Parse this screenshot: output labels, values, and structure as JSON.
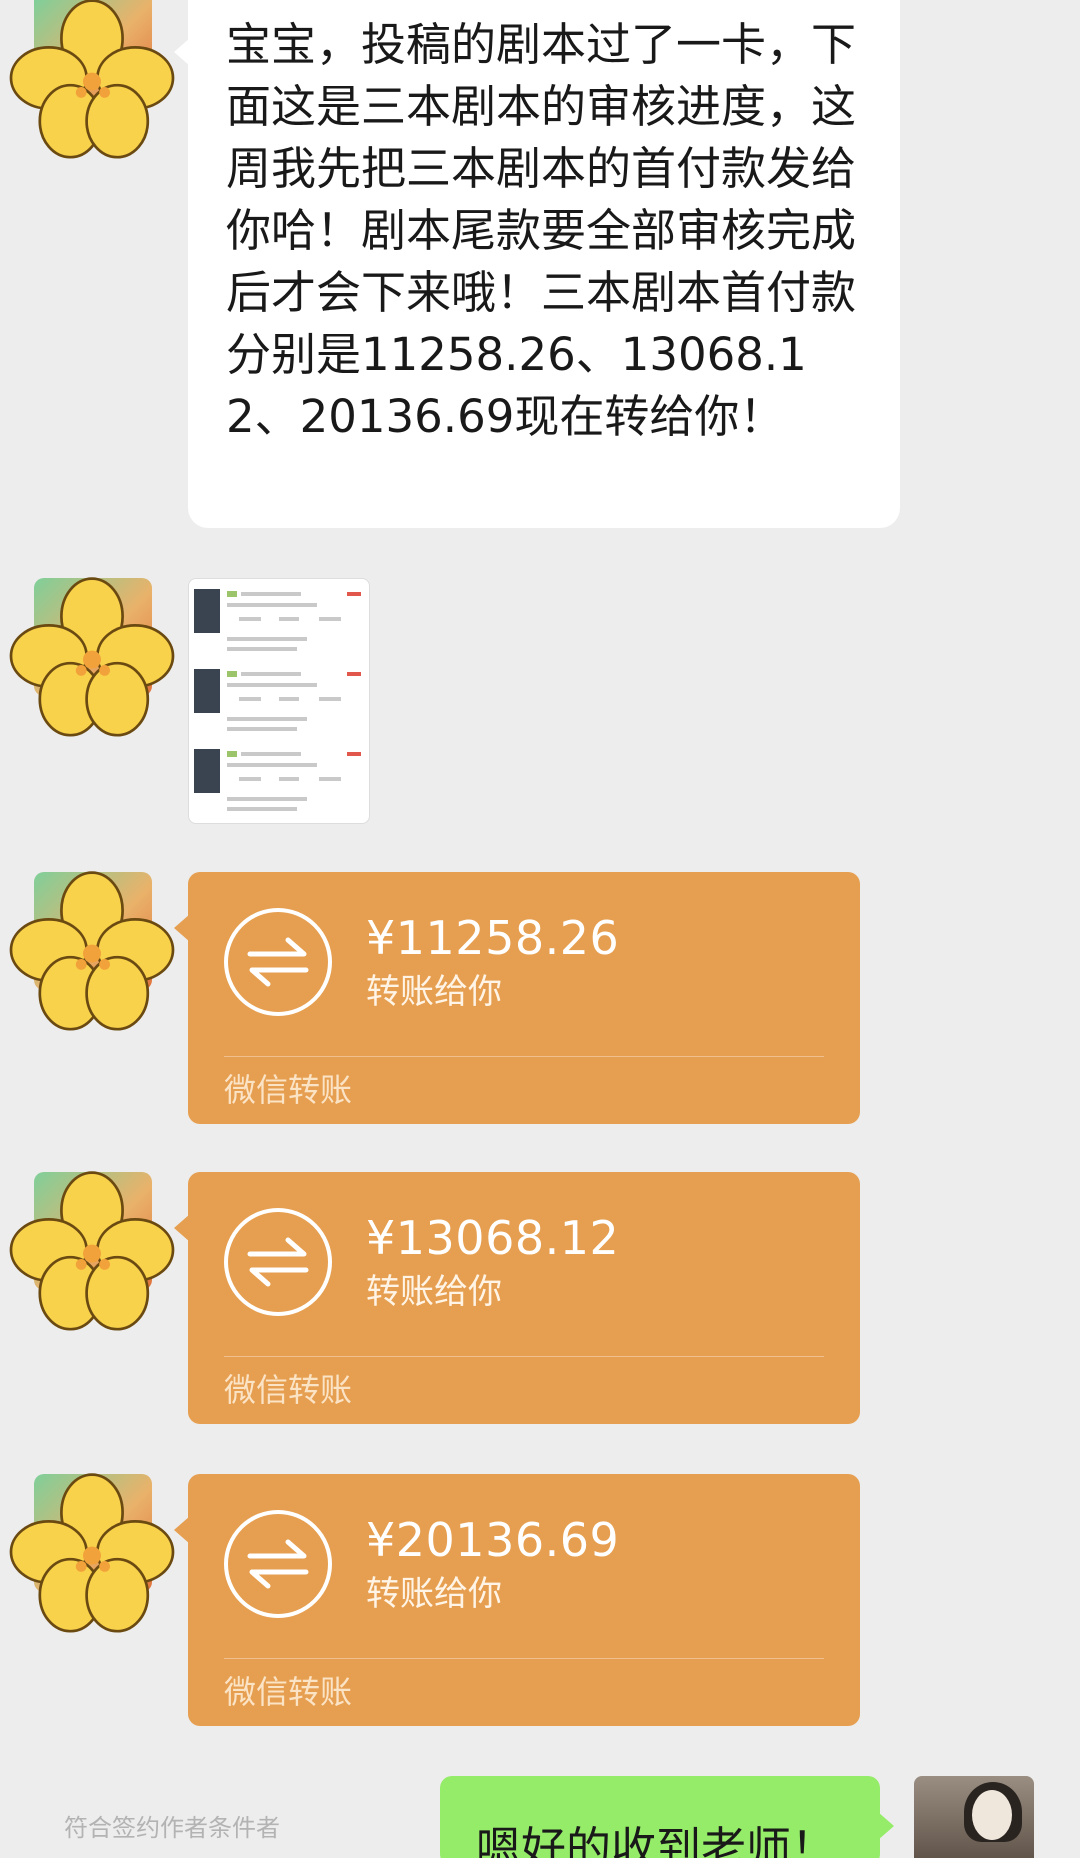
{
  "chat": {
    "message_text": "宝宝，投稿的剧本过了一卡，下面这是三本剧本的审核进度，这周我先把三本剧本的首付款发给你哈！剧本尾款要全部审核完成后才会下来哦！三本剧本首付款分别是11258.26、13068.12、20136.69现在转给你！",
    "transfers": [
      {
        "amount": "¥11258.26",
        "label": "转账给你",
        "footer": "微信转账"
      },
      {
        "amount": "¥13068.12",
        "label": "转账给你",
        "footer": "微信转账"
      },
      {
        "amount": "¥20136.69",
        "label": "转账给你",
        "footer": "微信转账"
      }
    ],
    "notice": "符合签约作者条件者",
    "reply_text": "嗯好的收到老师！"
  },
  "icons": {
    "avatar": "flower-sticker-avatar",
    "transfer": "transfer-arrows-icon",
    "self_avatar": "user-photo-avatar"
  },
  "colors": {
    "background": "#ededed",
    "transfer_orange": "#e69f50",
    "reply_green": "#95ec69",
    "bubble_white": "#ffffff"
  }
}
